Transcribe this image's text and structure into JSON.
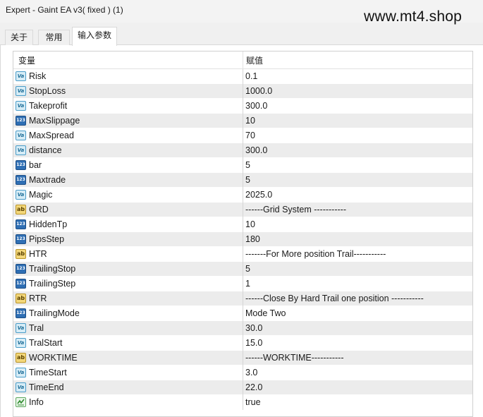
{
  "window": {
    "title": "Expert - Gaint  EA v3( fixed ) (1)"
  },
  "watermark": "www.mt4.shop",
  "tabs": [
    {
      "label": "关于"
    },
    {
      "label": "常用"
    },
    {
      "label": "输入参数",
      "active": true
    }
  ],
  "table": {
    "headers": {
      "variable": "变量",
      "value": "赋值"
    },
    "rows": [
      {
        "icon": "double-icon",
        "name": "Risk",
        "value": "0.1"
      },
      {
        "icon": "double-icon",
        "name": "StopLoss",
        "value": "1000.0"
      },
      {
        "icon": "double-icon",
        "name": "Takeprofit",
        "value": "300.0"
      },
      {
        "icon": "integer-icon",
        "name": "MaxSlippage",
        "value": "10"
      },
      {
        "icon": "double-icon",
        "name": "MaxSpread",
        "value": "70"
      },
      {
        "icon": "double-icon",
        "name": "distance",
        "value": "300.0"
      },
      {
        "icon": "integer-icon",
        "name": "bar",
        "value": "5"
      },
      {
        "icon": "integer-icon",
        "name": "Maxtrade",
        "value": "5"
      },
      {
        "icon": "double-icon",
        "name": "Magic",
        "value": "2025.0"
      },
      {
        "icon": "string-icon",
        "name": "GRD",
        "value": "------Grid System -----------"
      },
      {
        "icon": "integer-icon",
        "name": "HiddenTp",
        "value": "10"
      },
      {
        "icon": "integer-icon",
        "name": "PipsStep",
        "value": "180"
      },
      {
        "icon": "string-icon",
        "name": "HTR",
        "value": "-------For More position Trail-----------"
      },
      {
        "icon": "integer-icon",
        "name": "TrailingStop",
        "value": "5"
      },
      {
        "icon": "integer-icon",
        "name": "TrailingStep",
        "value": "1"
      },
      {
        "icon": "string-icon",
        "name": "RTR",
        "value": "------Close By Hard Trail one position -----------"
      },
      {
        "icon": "integer-icon",
        "name": "TrailingMode",
        "value": "Mode Two"
      },
      {
        "icon": "double-icon",
        "name": "Tral",
        "value": "30.0"
      },
      {
        "icon": "double-icon",
        "name": "TralStart",
        "value": "15.0"
      },
      {
        "icon": "string-icon",
        "name": "WORKTIME",
        "value": "------WORKTIME-----------"
      },
      {
        "icon": "double-icon",
        "name": "TimeStart",
        "value": "3.0"
      },
      {
        "icon": "double-icon",
        "name": "TimeEnd",
        "value": "22.0"
      },
      {
        "icon": "bool-icon",
        "name": "Info",
        "value": "true"
      }
    ]
  },
  "icon_glyphs": {
    "double-icon": "Va",
    "integer-icon": "123",
    "string-icon": "ab",
    "bool-icon": ""
  },
  "colors": {
    "row_alt": "#ececec",
    "panel": "#ffffff",
    "chrome": "#f0f0f0"
  }
}
